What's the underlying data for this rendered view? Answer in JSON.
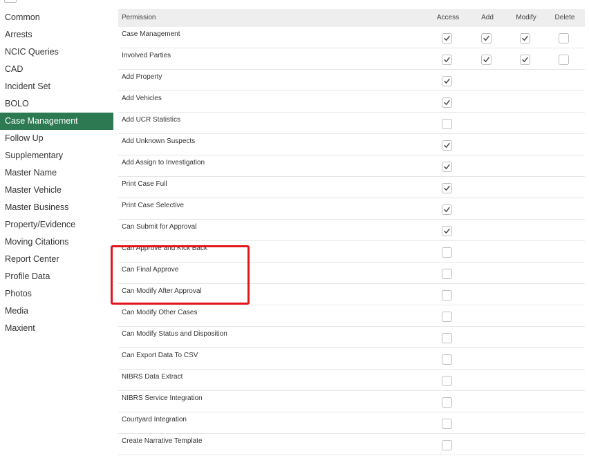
{
  "sidebar": {
    "items": [
      {
        "label": "Common",
        "active": false
      },
      {
        "label": "Arrests",
        "active": false
      },
      {
        "label": "NCIC Queries",
        "active": false
      },
      {
        "label": "CAD",
        "active": false
      },
      {
        "label": "Incident Set",
        "active": false
      },
      {
        "label": "BOLO",
        "active": false
      },
      {
        "label": "Case Management",
        "active": true
      },
      {
        "label": "Follow Up",
        "active": false
      },
      {
        "label": "Supplementary",
        "active": false
      },
      {
        "label": "Master Name",
        "active": false
      },
      {
        "label": "Master Vehicle",
        "active": false
      },
      {
        "label": "Master Business",
        "active": false
      },
      {
        "label": "Property/Evidence",
        "active": false
      },
      {
        "label": "Moving Citations",
        "active": false
      },
      {
        "label": "Report Center",
        "active": false
      },
      {
        "label": "Profile Data",
        "active": false
      },
      {
        "label": "Photos",
        "active": false
      },
      {
        "label": "Media",
        "active": false
      },
      {
        "label": "Maxient",
        "active": false
      }
    ]
  },
  "permissions": {
    "headers": {
      "permission": "Permission",
      "access": "Access",
      "add": "Add",
      "modify": "Modify",
      "delete": "Delete"
    },
    "rows": [
      {
        "label": "Case Management",
        "access": true,
        "add": true,
        "modify": true,
        "delete": false
      },
      {
        "label": "Involved Parties",
        "access": true,
        "add": true,
        "modify": true,
        "delete": false
      },
      {
        "label": "Add Property",
        "access": true
      },
      {
        "label": "Add Vehicles",
        "access": true
      },
      {
        "label": "Add UCR Statistics",
        "access": false
      },
      {
        "label": "Add Unknown Suspects",
        "access": true
      },
      {
        "label": "Add Assign to Investigation",
        "access": true
      },
      {
        "label": "Print Case Full",
        "access": true
      },
      {
        "label": "Print Case Selective",
        "access": true
      },
      {
        "label": "Can Submit for Approval",
        "access": true
      },
      {
        "label": "Can Approve and Kick Back",
        "access": false
      },
      {
        "label": "Can Final Approve",
        "access": false
      },
      {
        "label": "Can Modify After Approval",
        "access": false
      },
      {
        "label": "Can Modify Other Cases",
        "access": false
      },
      {
        "label": "Can Modify Status and Disposition",
        "access": false
      },
      {
        "label": "Can Export Data To CSV",
        "access": false
      },
      {
        "label": "NIBRS Data Extract",
        "access": false
      },
      {
        "label": "NIBRS Service Integration",
        "access": false
      },
      {
        "label": "Courtyard Integration",
        "access": false
      },
      {
        "label": "Create Narrative Template",
        "access": false
      }
    ]
  },
  "colors": {
    "active_item": "#2d7a52",
    "highlight": "#e3151b",
    "header_bg": "#eeeeee"
  }
}
